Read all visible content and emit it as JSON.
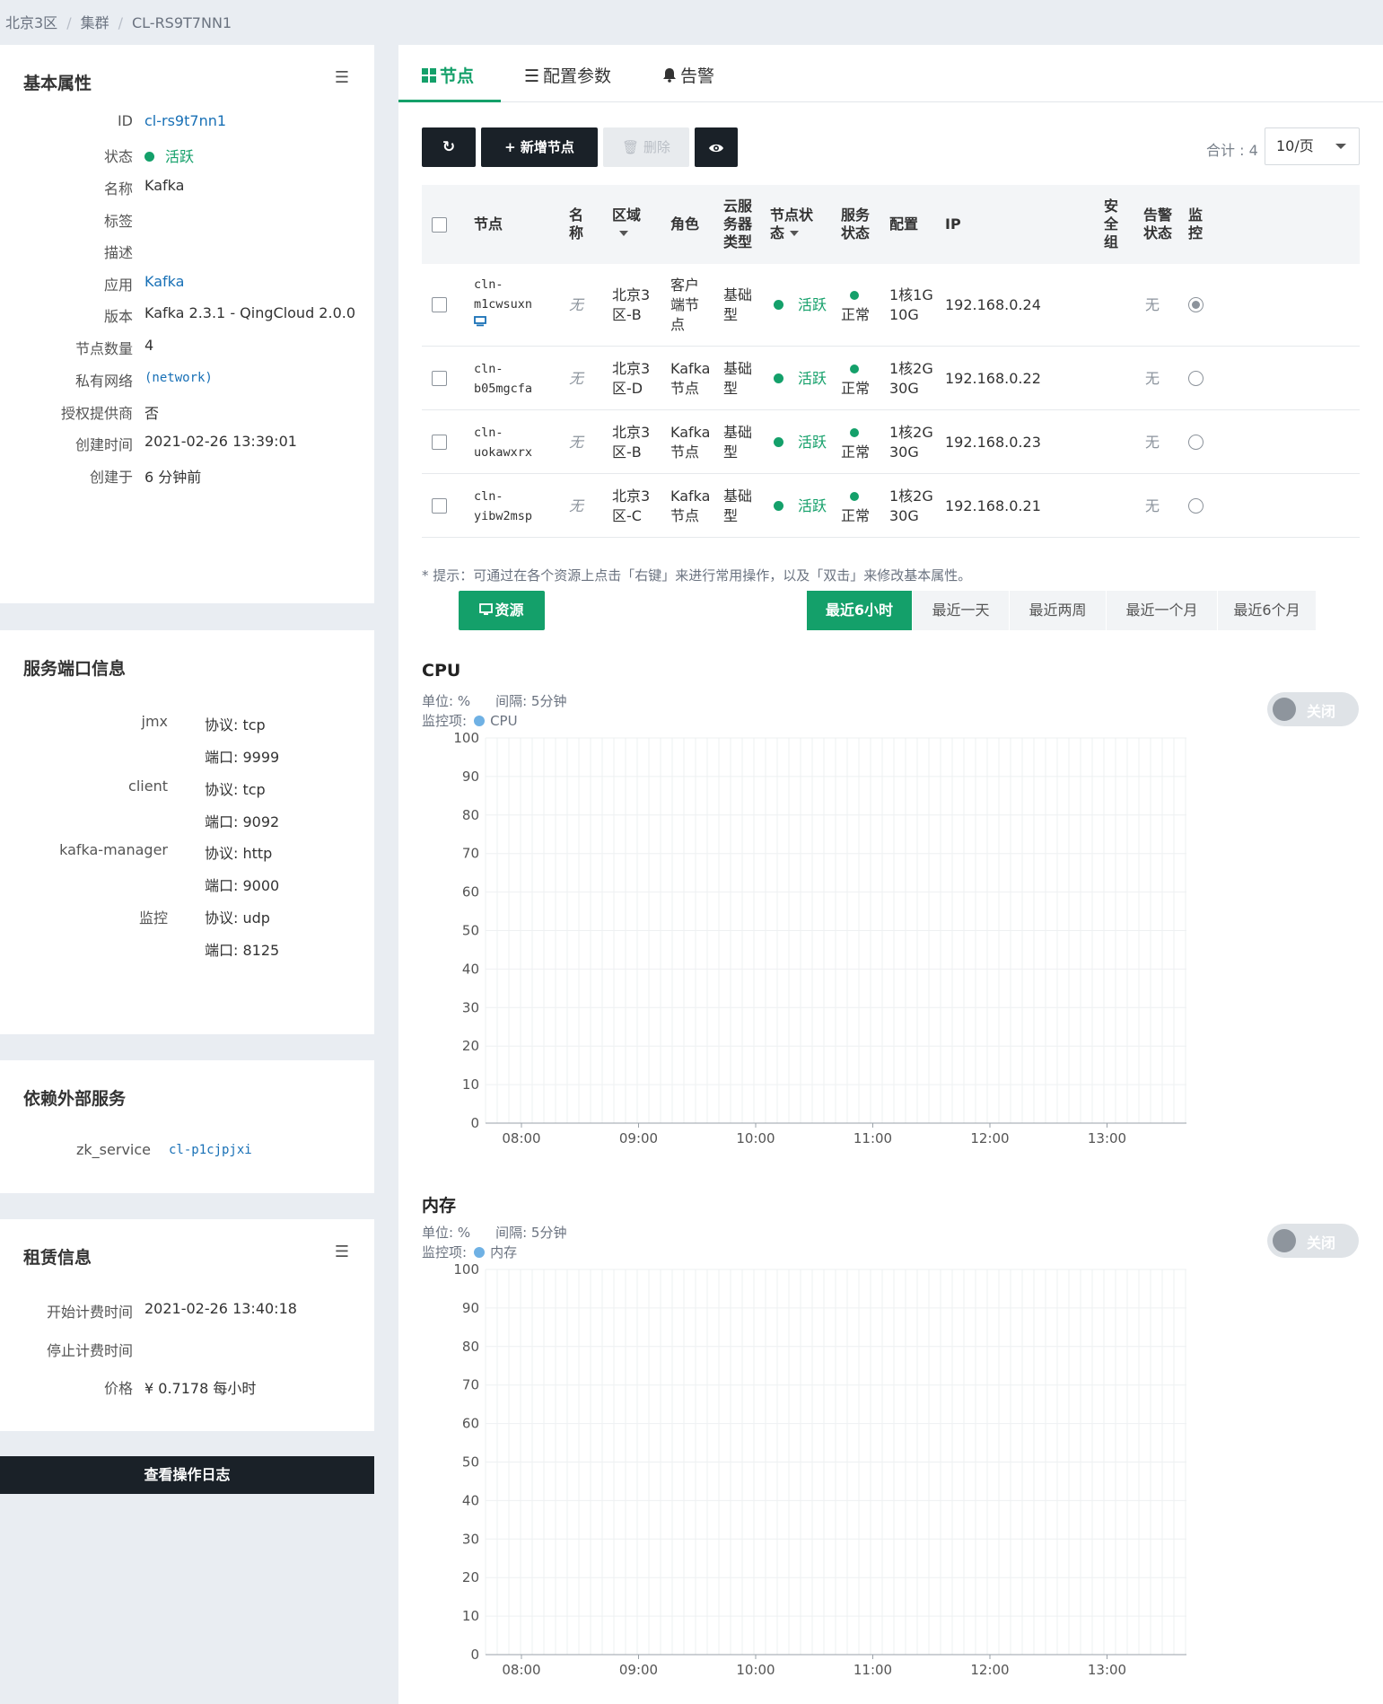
{
  "breadcrumb": [
    "北京3区",
    "集群",
    "CL-RS9T7NN1"
  ],
  "basic": {
    "title": "基本属性",
    "fields": [
      {
        "label": "ID",
        "value": "cl-rs9t7nn1"
      },
      {
        "label": "状态",
        "value": "活跃"
      },
      {
        "label": "名称",
        "value": "Kafka"
      },
      {
        "label": "标签",
        "value": ""
      },
      {
        "label": "描述",
        "value": ""
      },
      {
        "label": "应用",
        "value": "Kafka"
      },
      {
        "label": "版本",
        "value": "Kafka 2.3.1 - QingCloud 2.0.0"
      },
      {
        "label": "节点数量",
        "value": "4"
      },
      {
        "label": "私有网络",
        "value": "(network)"
      },
      {
        "label": "授权提供商",
        "value": "否"
      },
      {
        "label": "创建时间",
        "value": "2021-02-26 13:39:01"
      },
      {
        "label": "创建于",
        "value": "6 分钟前"
      }
    ]
  },
  "ports": {
    "title": "服务端口信息",
    "services": [
      {
        "name": "jmx",
        "protocol": "协议: tcp",
        "port": "端口: 9999"
      },
      {
        "name": "client",
        "protocol": "协议: tcp",
        "port": "端口: 9092"
      },
      {
        "name": "kafka-manager",
        "protocol": "协议: http",
        "port": "端口: 9000"
      },
      {
        "name": "监控",
        "protocol": "协议: udp",
        "port": "端口: 8125"
      }
    ]
  },
  "deps": {
    "title": "依赖外部服务",
    "key": "zk_service",
    "value": "cl-p1cjpjxi"
  },
  "lease": {
    "title": "租赁信息",
    "fields": [
      {
        "label": "开始计费时间",
        "value": "2021-02-26 13:40:18"
      },
      {
        "label": "停止计费时间",
        "value": ""
      },
      {
        "label": "价格",
        "value": "¥ 0.7178  每小时"
      }
    ]
  },
  "log_button": "查看操作日志",
  "tabs": [
    "节点",
    "配置参数",
    "告警"
  ],
  "toolbar": {
    "add": "新增节点",
    "delete": "删除",
    "total": "合计 : 4",
    "page_size": "10/页"
  },
  "table": {
    "headers": {
      "node": "节点",
      "name": [
        "名",
        "称"
      ],
      "zone": "区域",
      "role": "角色",
      "type": [
        "云服",
        "务器",
        "类型"
      ],
      "node_status": [
        "节点状",
        "态"
      ],
      "svc_status": [
        "服务",
        "状态"
      ],
      "config": "配置",
      "ip": "IP",
      "sg": [
        "安",
        "全",
        "组"
      ],
      "alarm": [
        "告警",
        "状态"
      ],
      "monitor": [
        "监",
        "控"
      ]
    },
    "rows": [
      {
        "node": [
          "cln-",
          "m1cwsuxn"
        ],
        "name": "无",
        "zone": [
          "北京3",
          "区-B"
        ],
        "role": [
          "客户",
          "端节",
          "点"
        ],
        "type": [
          "基础",
          "型"
        ],
        "status": "活跃",
        "svc": "正常",
        "config": [
          "1核1G",
          "10G"
        ],
        "ip": "192.168.0.24",
        "alarm": "无",
        "selected": true,
        "has_icon": true
      },
      {
        "node": [
          "cln-",
          "b05mgcfa"
        ],
        "name": "无",
        "zone": [
          "北京3",
          "区-D"
        ],
        "role": [
          "Kafka",
          "节点"
        ],
        "type": [
          "基础",
          "型"
        ],
        "status": "活跃",
        "svc": "正常",
        "config": [
          "1核2G",
          "30G"
        ],
        "ip": "192.168.0.22",
        "alarm": "无",
        "selected": false,
        "has_icon": false
      },
      {
        "node": [
          "cln-",
          "uokawxrx"
        ],
        "name": "无",
        "zone": [
          "北京3",
          "区-B"
        ],
        "role": [
          "Kafka",
          "节点"
        ],
        "type": [
          "基础",
          "型"
        ],
        "status": "活跃",
        "svc": "正常",
        "config": [
          "1核2G",
          "30G"
        ],
        "ip": "192.168.0.23",
        "alarm": "无",
        "selected": false,
        "has_icon": false
      },
      {
        "node": [
          "cln-",
          "yibw2msp"
        ],
        "name": "无",
        "zone": [
          "北京3",
          "区-C"
        ],
        "role": [
          "Kafka",
          "节点"
        ],
        "type": [
          "基础",
          "型"
        ],
        "status": "活跃",
        "svc": "正常",
        "config": [
          "1核2G",
          "30G"
        ],
        "ip": "192.168.0.21",
        "alarm": "无",
        "selected": false,
        "has_icon": false
      }
    ]
  },
  "tip": "* 提示：可通过在各个资源上点击「右键」来进行常用操作，以及「双击」来修改基本属性。",
  "resource_button": "资源",
  "ranges": [
    "最近6小时",
    "最近一天",
    "最近两周",
    "最近一个月",
    "最近6个月"
  ],
  "charts": [
    {
      "title": "CPU",
      "unit": "单位: %",
      "interval": "间隔: 5分钟",
      "metric_label": "监控项:",
      "metric": "CPU",
      "toggle": "关闭"
    },
    {
      "title": "内存",
      "unit": "单位: %",
      "interval": "间隔: 5分钟",
      "metric_label": "监控项:",
      "metric": "内存",
      "toggle": "关闭"
    }
  ],
  "chart_data": [
    {
      "type": "line",
      "title": "CPU",
      "series": [
        {
          "name": "CPU",
          "values": []
        }
      ],
      "x_ticks": [
        "08:00",
        "09:00",
        "10:00",
        "11:00",
        "12:00",
        "13:00"
      ],
      "y_ticks": [
        0,
        10,
        20,
        30,
        40,
        50,
        60,
        70,
        80,
        90,
        100
      ],
      "ylim": [
        0,
        100
      ],
      "grid": true
    },
    {
      "type": "line",
      "title": "内存",
      "series": [
        {
          "name": "内存",
          "values": []
        }
      ],
      "x_ticks": [
        "08:00",
        "09:00",
        "10:00",
        "11:00",
        "12:00",
        "13:00"
      ],
      "y_ticks": [
        0,
        10,
        20,
        30,
        40,
        50,
        60,
        70,
        80,
        90,
        100
      ],
      "ylim": [
        0,
        100
      ],
      "grid": true
    }
  ]
}
